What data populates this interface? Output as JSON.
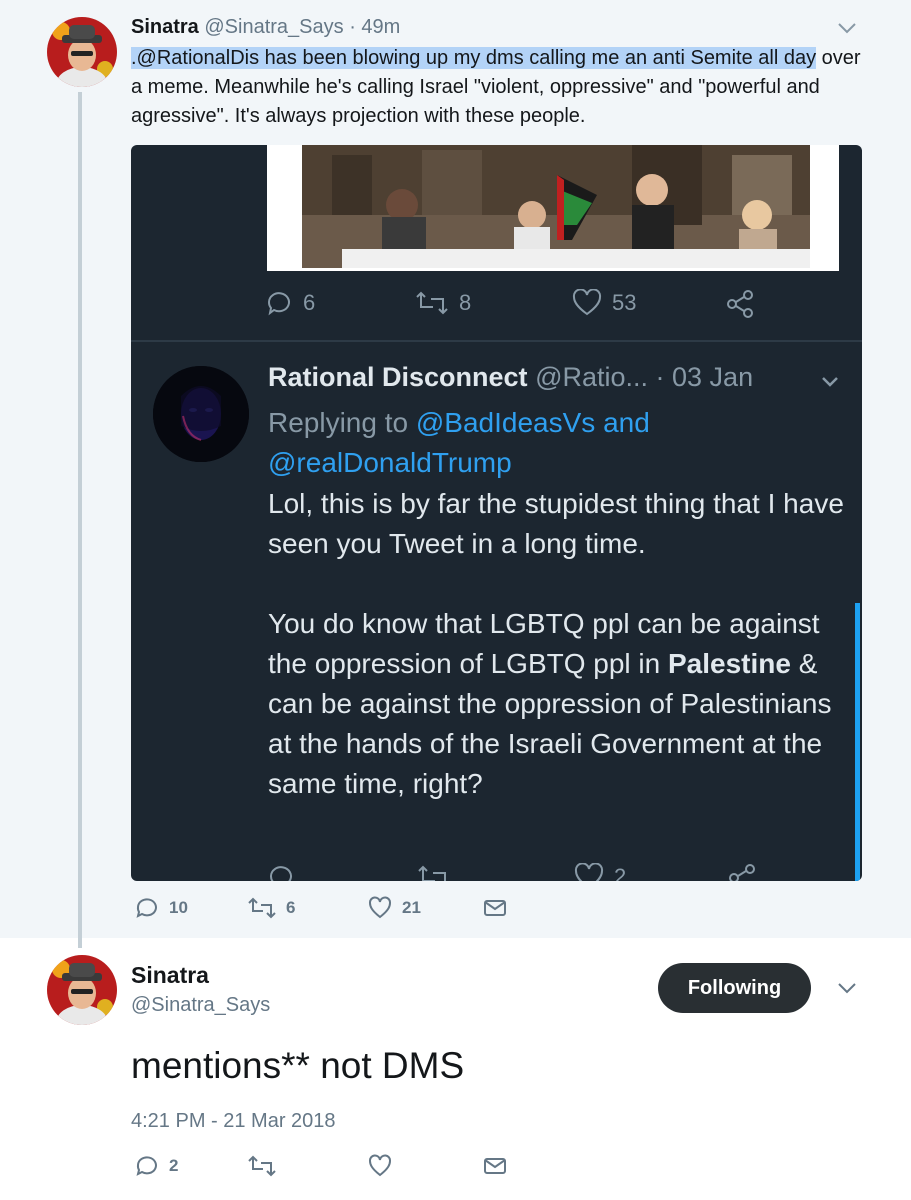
{
  "parent_tweet": {
    "name": "Sinatra",
    "handle": "@Sinatra_Says",
    "time": "· 49m",
    "text_highlighted": ".@RationalDis has been blowing up my dms calling me an anti Semite all day",
    "text_rest": " over a meme. Meanwhile he's calling Israel \"violent, oppressive\" and \"powerful and agressive\". It's always projection with these people.",
    "replies": "10",
    "retweets": "6",
    "likes": "21"
  },
  "embedded_screenshot": {
    "top_actions": {
      "replies": "6",
      "retweets": "8",
      "likes": "53"
    },
    "name": "Rational Disconnect",
    "handle": "@Ratio...",
    "time": "· 03 Jan",
    "replying_prefix": "Replying to ",
    "replying_to_1": "@BadIdeasVs and",
    "replying_to_2": "@realDonaldTrump",
    "para1": "Lol, this is by far the stupidest thing that I have seen you Tweet in a long time.",
    "para2_a": "You do know that LGBTQ ppl can be against the oppression of LGBTQ ppl in ",
    "para2_bold": "Palestine",
    "para2_b": " & can be against the oppression of Palestinians at the hands of the Israeli Government at the same time, right?",
    "bottom_likes": "2"
  },
  "main_tweet": {
    "name": "Sinatra",
    "handle": "@Sinatra_Says",
    "follow_label": "Following",
    "text": "mentions** not DMS",
    "timestamp": "4:21 PM - 21 Mar 2018",
    "replies": "2"
  },
  "colors": {
    "background": "#ffffff",
    "parent_background": "#f2f6f9",
    "embed_background": "#1c2630",
    "link_blue": "#2fa0f0",
    "highlight": "#b3d3f7",
    "muted": "#657786",
    "follow_button": "#292f33"
  },
  "icons": [
    "reply-icon",
    "retweet-icon",
    "like-icon",
    "share-icon",
    "direct-message-icon",
    "chevron-down-icon"
  ]
}
